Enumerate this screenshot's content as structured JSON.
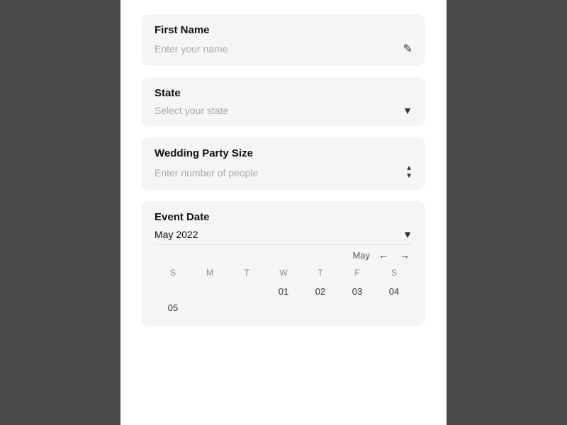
{
  "panel": {
    "background": "#ffffff"
  },
  "firstNameField": {
    "label": "First Name",
    "placeholder": "Enter your name",
    "editIconSymbol": "✎"
  },
  "stateField": {
    "label": "State",
    "placeholder": "Select your state",
    "arrowSymbol": "▼"
  },
  "weddingPartySizeField": {
    "label": "Wedding Party Size",
    "placeholder": "Enter number of people",
    "spinnerUp": "▲",
    "spinnerDown": "▼"
  },
  "eventDateField": {
    "label": "Event Date",
    "monthValue": "May 2022",
    "arrowSymbol": "▼",
    "monthNavLabel": "May",
    "prevArrow": "←",
    "nextArrow": "→",
    "weekdays": [
      "S",
      "M",
      "T",
      "W",
      "T",
      "F",
      "S"
    ],
    "calendarRows": [
      [
        "",
        "",
        "",
        "",
        "",
        "",
        ""
      ],
      [
        "",
        "",
        "",
        "01",
        "02",
        "03",
        "04",
        "05"
      ]
    ],
    "startOffset": 0
  }
}
